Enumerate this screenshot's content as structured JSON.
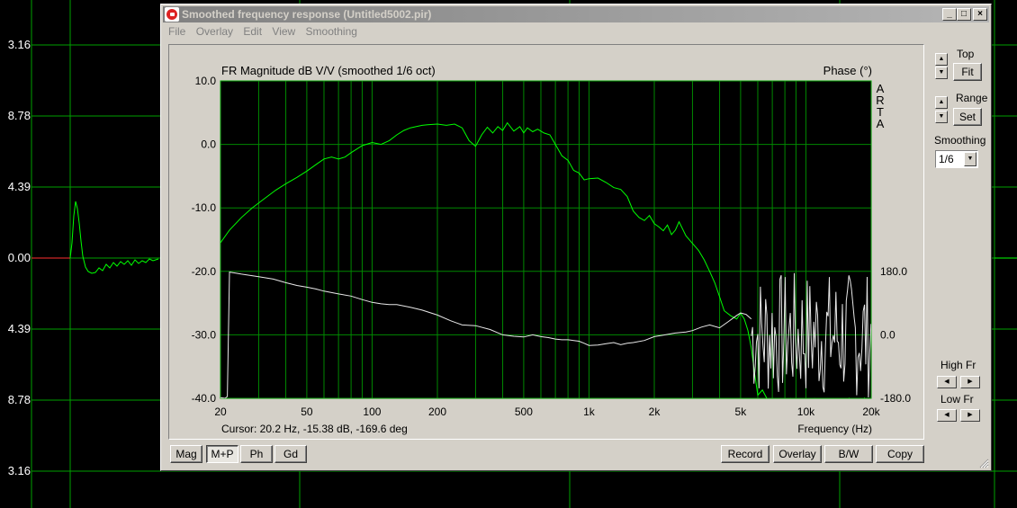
{
  "background_plot": {
    "tick_labels": [
      "3.16",
      "8.78",
      "4.39",
      "0.00",
      "4.39",
      "8.78",
      "3.16"
    ],
    "grid_color": "#00a000",
    "trace_color": "#00ff00"
  },
  "window": {
    "title": "Smoothed frequency response (Untitled5002.pir)",
    "controls": [
      "_",
      "□",
      "×"
    ]
  },
  "menu": [
    "File",
    "Overlay",
    "Edit",
    "View",
    "Smoothing"
  ],
  "chart_data": {
    "type": "line",
    "title": "FR Magnitude dB V/V (smoothed 1/6 oct)",
    "right_title": "Phase (°)",
    "watermark": [
      "A",
      "R",
      "T",
      "A"
    ],
    "xlabel": "Frequency (Hz)",
    "x_scale": "log",
    "xlim": [
      20,
      20000
    ],
    "x_ticks": [
      20,
      50,
      100,
      200,
      500,
      1000,
      2000,
      5000,
      10000,
      20000
    ],
    "x_tick_labels": [
      "20",
      "50",
      "100",
      "200",
      "500",
      "1k",
      "2k",
      "5k",
      "10k",
      "20k"
    ],
    "ylim": [
      -40,
      10
    ],
    "y_ticks": [
      10,
      0,
      -10,
      -20,
      -30,
      -40
    ],
    "y_tick_labels": [
      "10.0",
      "0.0",
      "-10.0",
      "-20.0",
      "-30.0",
      "-40.0"
    ],
    "y2lim": [
      -180,
      180
    ],
    "y2_ticks": [
      180,
      0,
      -180
    ],
    "y2_tick_labels": [
      "180.0",
      "0.0",
      "-180.0"
    ],
    "series": [
      {
        "color": "#00ff00",
        "axis": "left",
        "x": [
          20,
          22,
          25,
          28,
          32,
          36,
          40,
          45,
          50,
          56,
          60,
          65,
          70,
          75,
          80,
          90,
          100,
          110,
          120,
          130,
          140,
          150,
          160,
          170,
          180,
          200,
          220,
          240,
          260,
          280,
          300,
          320,
          340,
          360,
          380,
          400,
          420,
          450,
          480,
          500,
          520,
          550,
          580,
          620,
          660,
          700,
          750,
          800,
          850,
          900,
          950,
          1000,
          1100,
          1200,
          1300,
          1400,
          1500,
          1600,
          1700,
          1800,
          1900,
          2000,
          2100,
          2200,
          2300,
          2400,
          2500,
          2600,
          2800,
          3000,
          3200,
          3400,
          3600,
          3800,
          4000,
          4200,
          4500,
          4800,
          5000,
          5200,
          5400,
          5600,
          5800,
          6000,
          6300,
          6600
        ],
        "values": [
          -15.5,
          -13.5,
          -11.5,
          -10,
          -8.5,
          -7.2,
          -6.2,
          -5.2,
          -4.2,
          -3,
          -2.3,
          -2,
          -2.3,
          -2,
          -1.3,
          -0.2,
          0.3,
          0,
          0.6,
          1.5,
          2.2,
          2.6,
          2.8,
          3,
          3.1,
          3.2,
          3.0,
          3.2,
          2.6,
          0.6,
          -0.3,
          1.5,
          2.7,
          1.8,
          2.8,
          2.2,
          3.4,
          2.1,
          2.8,
          1.8,
          2.6,
          2.0,
          2.4,
          1.8,
          1.5,
          0,
          -1.8,
          -2.5,
          -4.1,
          -4.5,
          -5.6,
          -5.4,
          -5.3,
          -6,
          -6.8,
          -7.1,
          -8.2,
          -10.5,
          -11.5,
          -12.0,
          -11.2,
          -12.5,
          -13.0,
          -13.6,
          -12.7,
          -14.2,
          -13.5,
          -12.2,
          -14.4,
          -15.6,
          -16.7,
          -18.2,
          -20.0,
          -21.8,
          -24.0,
          -26.2,
          -27.0,
          -27.5,
          -26.6,
          -27.5,
          -29.3,
          -32.1,
          -36.0,
          -39.5,
          -38.7,
          -40.0
        ]
      },
      {
        "color": "#e8e8e8",
        "axis": "right",
        "x": [
          20,
          21,
          21.5,
          22,
          23,
          25,
          30,
          35,
          40,
          45,
          50,
          55,
          60,
          70,
          80,
          90,
          100,
          110,
          120,
          130,
          150,
          170,
          200,
          230,
          260,
          300,
          350,
          400,
          450,
          500,
          550,
          600,
          650,
          700,
          750,
          800,
          850,
          900,
          950,
          1000,
          1100,
          1200,
          1300,
          1400,
          1500,
          1600,
          1800,
          2000,
          2200,
          2500,
          2800,
          3000,
          3300,
          3600,
          4000,
          4400,
          4800,
          5000,
          5300,
          5600
        ],
        "values": [
          -178,
          -180,
          -175,
          178,
          176,
          172,
          165,
          158,
          148,
          140,
          135,
          130,
          124,
          116,
          110,
          100,
          92,
          88,
          86,
          86,
          78,
          70,
          56,
          40,
          28,
          26,
          15,
          0,
          -4,
          -6,
          0,
          -5,
          -8,
          -12,
          -14,
          -14,
          -16,
          -18,
          -24,
          -30,
          -29,
          -25,
          -22,
          -28,
          -24,
          -22,
          -16,
          -5,
          -1,
          5,
          8,
          12,
          22,
          28,
          20,
          38,
          55,
          62,
          58,
          45
        ]
      }
    ]
  },
  "cursor_text": "Cursor: 20.2 Hz, -15.38 dB, -169.6 deg",
  "bottom_left_buttons": [
    "Mag",
    "M+P",
    "Ph",
    "Gd"
  ],
  "bottom_right_buttons": [
    "Record",
    "Overlay",
    "B/W",
    "Copy"
  ],
  "side": {
    "top_label": "Top",
    "fit_button": "Fit",
    "range_label": "Range",
    "set_button": "Set",
    "smoothing_label": "Smoothing",
    "smoothing_value": "1/6",
    "high_fr_label": "High Fr",
    "low_fr_label": "Low Fr"
  }
}
